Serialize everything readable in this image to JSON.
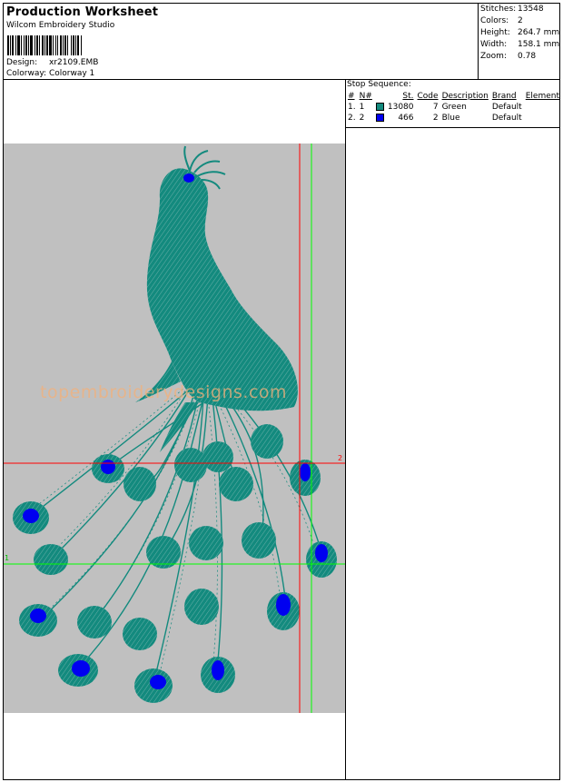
{
  "header": {
    "title": "Production Worksheet",
    "software": "Wilcom Embroidery Studio",
    "design_label": "Design:",
    "design_value": "xr2109.EMB",
    "colorway_label": "Colorway:",
    "colorway_value": "Colorway 1"
  },
  "stats": [
    {
      "label": "Stitches:",
      "value": "13548"
    },
    {
      "label": "Colors:",
      "value": "2"
    },
    {
      "label": "Height:",
      "value": "264.7 mm"
    },
    {
      "label": "Width:",
      "value": "158.1 mm"
    },
    {
      "label": "Zoom:",
      "value": "0.78"
    }
  ],
  "stop_sequence": {
    "title": "Stop Sequence:",
    "columns": [
      "#",
      "N#",
      "St.",
      "Code",
      "Description",
      "Brand",
      "Element"
    ],
    "rows": [
      {
        "num": "1.",
        "n": "1",
        "color": "#138a7e",
        "st": "13080",
        "code": "7",
        "description": "Green",
        "brand": "Default",
        "element": ""
      },
      {
        "num": "2.",
        "n": "2",
        "color": "#0000f0",
        "st": "466",
        "code": "2",
        "description": "Blue",
        "brand": "Default",
        "element": ""
      }
    ]
  },
  "preview": {
    "watermark": "topembroiderydesigns.com",
    "marker_red": "2",
    "marker_green": "1",
    "colors": {
      "background": "#c0c0c0",
      "thread_green": "#138a7e",
      "thread_blue": "#0000f0",
      "guide_red": "#ff0000",
      "guide_green": "#00ff00"
    }
  }
}
